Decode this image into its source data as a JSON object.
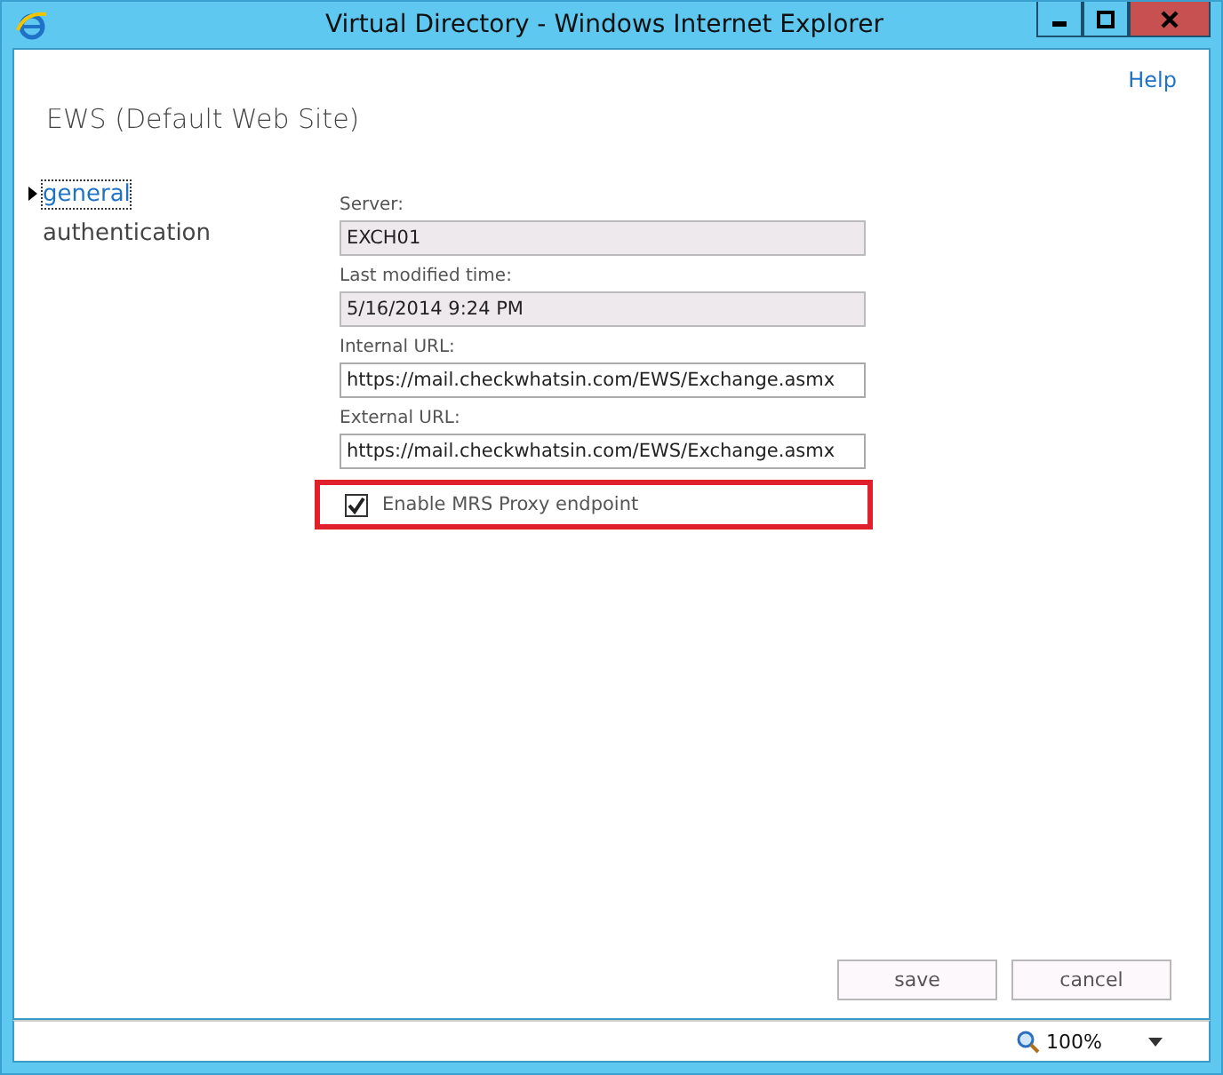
{
  "window": {
    "title": "Virtual Directory - Windows Internet Explorer"
  },
  "help": "Help",
  "heading": "EWS (Default Web Site)",
  "nav": [
    {
      "label": "general",
      "selected": true
    },
    {
      "label": "authentication",
      "selected": false
    }
  ],
  "fields": [
    {
      "label": "Server:",
      "value": "EXCH01",
      "readonly": true
    },
    {
      "label": "Last modified time:",
      "value": "5/16/2014 9:24 PM",
      "readonly": true
    },
    {
      "label": "Internal URL:",
      "value": "https://mail.checkwhatsin.com/EWS/Exchange.asmx",
      "readonly": false
    },
    {
      "label": "External URL:",
      "value": "https://mail.checkwhatsin.com/EWS/Exchange.asmx",
      "readonly": false
    }
  ],
  "mrs_proxy": {
    "label": "Enable MRS Proxy endpoint",
    "checked": true,
    "highlighted": true
  },
  "buttons": [
    "save",
    "cancel"
  ],
  "status_bar": {
    "zoom": "100%"
  }
}
